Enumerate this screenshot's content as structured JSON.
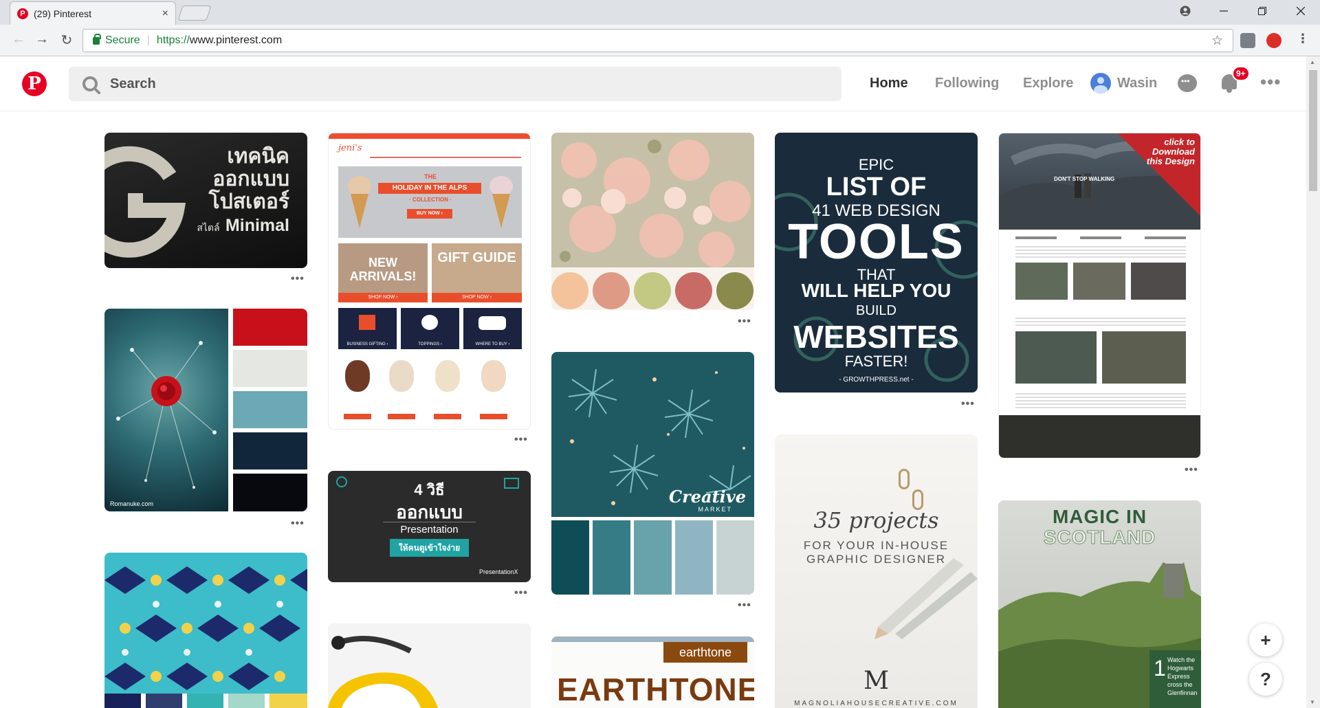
{
  "browser": {
    "tab_title": "(29) Pinterest",
    "tab_favicon": "P",
    "tab_close": "×",
    "secure_label": "Secure",
    "url_scheme": "https://",
    "url_host": "www.pinterest.com",
    "window_controls": [
      "minimize",
      "restore",
      "close"
    ]
  },
  "header": {
    "logo": "P",
    "search_placeholder": "Search",
    "nav": [
      "Home",
      "Following",
      "Explore"
    ],
    "user_name": "Wasin",
    "notification_badge": "9+",
    "more": "•••"
  },
  "pins": {
    "p1": {
      "line1": "เทคนิค",
      "line2": "ออกแบบ",
      "line3": "โปสเตอร์",
      "line4a": "สไตล์",
      "line4b": "Minimal"
    },
    "p2": {
      "credit": "Romanuke.com",
      "palette": [
        "#c8101a",
        "#e4e7e2",
        "#6aa9b5",
        "#12263b",
        "#08090e"
      ]
    },
    "p3": {
      "palette": [
        "#19215a",
        "#2f3e6e",
        "#33b3b2",
        "#a4d8c8",
        "#f2d24a"
      ]
    },
    "p4": {
      "brand": "jeni's",
      "hero_title": "THE",
      "hero_subtitle": "HOLIDAY IN THE ALPS",
      "hero_collection": "· COLLECTION ·",
      "hero_cta": "BUY NOW ›",
      "tile1": "NEW ARRIVALS!",
      "tile2": "GIFT GUIDE",
      "tile_cta": "SHOP NOW ›",
      "cats": [
        "BUSINESS GIFTING ›",
        "TOPPINGS ›",
        "WHERE TO BUY ›"
      ]
    },
    "p5": {
      "line1": "4 วิธี",
      "line2": "ออกแบบ",
      "line3": "Presentation",
      "button": "ให้คนดูเข้าใจง่าย",
      "brand": "PresentationX"
    },
    "p7": {
      "palette": [
        "#f4c39c",
        "#de9a84",
        "#c3c883",
        "#c86b67",
        "#8a8a4d"
      ]
    },
    "p8": {
      "brand": "Creative",
      "brand_sub": "MARKET",
      "palette": [
        "#0f4d56",
        "#357c86",
        "#68a2ab",
        "#8fb5c3",
        "#c7d3d2"
      ]
    },
    "p9": {
      "tag": "earthtone",
      "title": "EARTHTONE"
    },
    "p10": {
      "epic": "EPIC",
      "list": "LIST OF",
      "web": "41 WEB DESIGN",
      "tools": "TOOLS",
      "that": "THAT",
      "will": "WILL HELP YOU",
      "build": "BUILD",
      "websites": "WEBSITES",
      "faster": "FASTER!",
      "source": "- GROWTHPRESS.net -"
    },
    "p11": {
      "title": "35 projects",
      "sub1": "FOR YOUR IN-HOUSE",
      "sub2": "GRAPHIC DESIGNER",
      "monogram": "M",
      "footer": "MAGNOLIAHOUSECREATIVE.COM"
    },
    "p12": {
      "corner": "click to Download this Design",
      "hero_text": "DON'T STOP WALKING"
    },
    "p13": {
      "line1": "MAGIC IN",
      "line2": "SCOTLAND",
      "number": "1",
      "caption": "Watch the Hogwarts Express cross the Glenfinnan"
    }
  },
  "pin_more": "•••",
  "fab": {
    "add": "+",
    "help": "?"
  }
}
